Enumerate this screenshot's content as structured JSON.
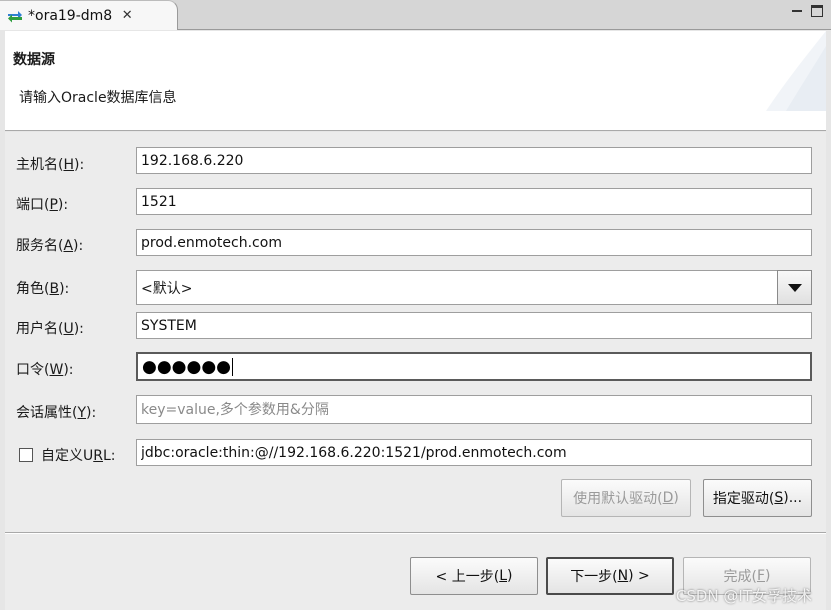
{
  "tab": {
    "title": "*ora19-dm8",
    "close_glyph": "✕",
    "icon": "sync-arrows-icon"
  },
  "window": {
    "minimize_icon": "minimize-icon",
    "maximize_icon": "maximize-icon"
  },
  "header": {
    "title": "数据源",
    "description": "请输入Oracle数据库信息"
  },
  "form": {
    "host": {
      "label": "主机名(",
      "mnemonic": "H",
      "label_end": "):",
      "value": "192.168.6.220"
    },
    "port": {
      "label": "端口(",
      "mnemonic": "P",
      "label_end": "):",
      "value": "1521"
    },
    "service": {
      "label": "服务名(",
      "mnemonic": "A",
      "label_end": "):",
      "value": "prod.enmotech.com"
    },
    "role": {
      "label": "角色(",
      "mnemonic": "B",
      "label_end": "):",
      "selected": "<默认>"
    },
    "user": {
      "label": "用户名(",
      "mnemonic": "U",
      "label_end": "):",
      "value": "SYSTEM"
    },
    "password": {
      "label": "口令(",
      "mnemonic": "W",
      "label_end": "):",
      "masked": "●●●●●●"
    },
    "session": {
      "label": "会话属性(",
      "mnemonic": "Y",
      "label_end": "):",
      "placeholder": "key=value,多个参数用&分隔"
    },
    "custom_url": {
      "label_pre": "自定义U",
      "mnemonic": "R",
      "label_post": "L:",
      "checked": false,
      "value": "jdbc:oracle:thin:@//192.168.6.220:1521/prod.enmotech.com"
    }
  },
  "driver_buttons": {
    "default_driver": {
      "label": "使用默认驱动(",
      "mnemonic": "D",
      "label_end": ")",
      "enabled": false
    },
    "specify_driver": {
      "label": "指定驱动(",
      "mnemonic": "S",
      "label_end": ")...",
      "enabled": true
    }
  },
  "footer": {
    "back": {
      "label": "< 上一步(",
      "mnemonic": "L",
      "label_end": ")"
    },
    "next": {
      "label": "下一步(",
      "mnemonic": "N",
      "label_end": ") >"
    },
    "finish": {
      "label": "完成(",
      "mnemonic": "F",
      "label_end": ")",
      "enabled": false
    }
  },
  "watermark": "CSDN @IT女孚技术"
}
